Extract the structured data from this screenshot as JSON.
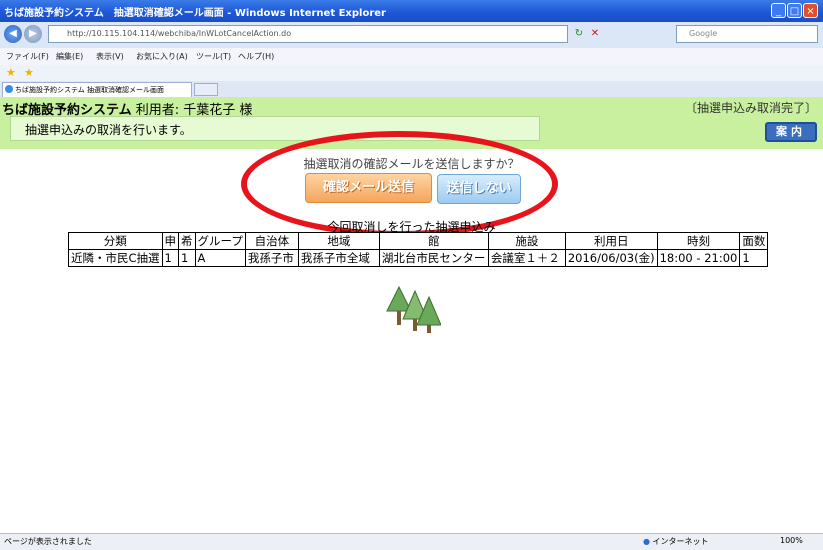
{
  "window": {
    "title": "ちば施設予約システム　抽選取消確認メール画面 - Windows Internet Explorer"
  },
  "addressbar": {
    "url": "http://10.115.104.114/webchiba/InWLotCancelAction.do",
    "search_placeholder": "Google"
  },
  "menu": [
    "ファイル(F)",
    "編集(E)",
    "表示(V)",
    "お気に入り(A)",
    "ツール(T)",
    "ヘルプ(H)"
  ],
  "tab": {
    "label": "ちば施設予約システム 抽選取消確認メール画面"
  },
  "header": {
    "system_name": "ちば施設予約システム",
    "user_label": "利用者: 千葉花子 様",
    "status": "〔抽選申込み取消完了〕",
    "message": "抽選申込みの取消を行います。",
    "guide_button": "案内"
  },
  "content": {
    "question": "抽選取消の確認メールを送信しますか？",
    "send_button": "確認メール送信",
    "nosend_button": "送信しない",
    "table_caption": "今回取消しを行った抽選申込み",
    "table": {
      "headers": [
        "分類",
        "申",
        "希",
        "グループ",
        "自治体",
        "地域",
        "館",
        "施設",
        "利用日",
        "時刻",
        "面数"
      ],
      "rows": [
        [
          "近隣・市民C抽選",
          "1",
          "1",
          "A",
          "我孫子市",
          "我孫子市全域",
          "湖北台市民センター",
          "会議室１＋２",
          "2016/06/03(金)",
          "18:00 - 21:00",
          "1"
        ]
      ]
    }
  },
  "statusbar": {
    "left": "ページが表示されました",
    "zone": "インターネット",
    "zoom": "100%"
  },
  "colors": {
    "header_bg": "#c8f09e",
    "annotation_ellipse": "#e8141b",
    "send_button": "#f4a55c",
    "nosend_button": "#9ccaf1"
  }
}
